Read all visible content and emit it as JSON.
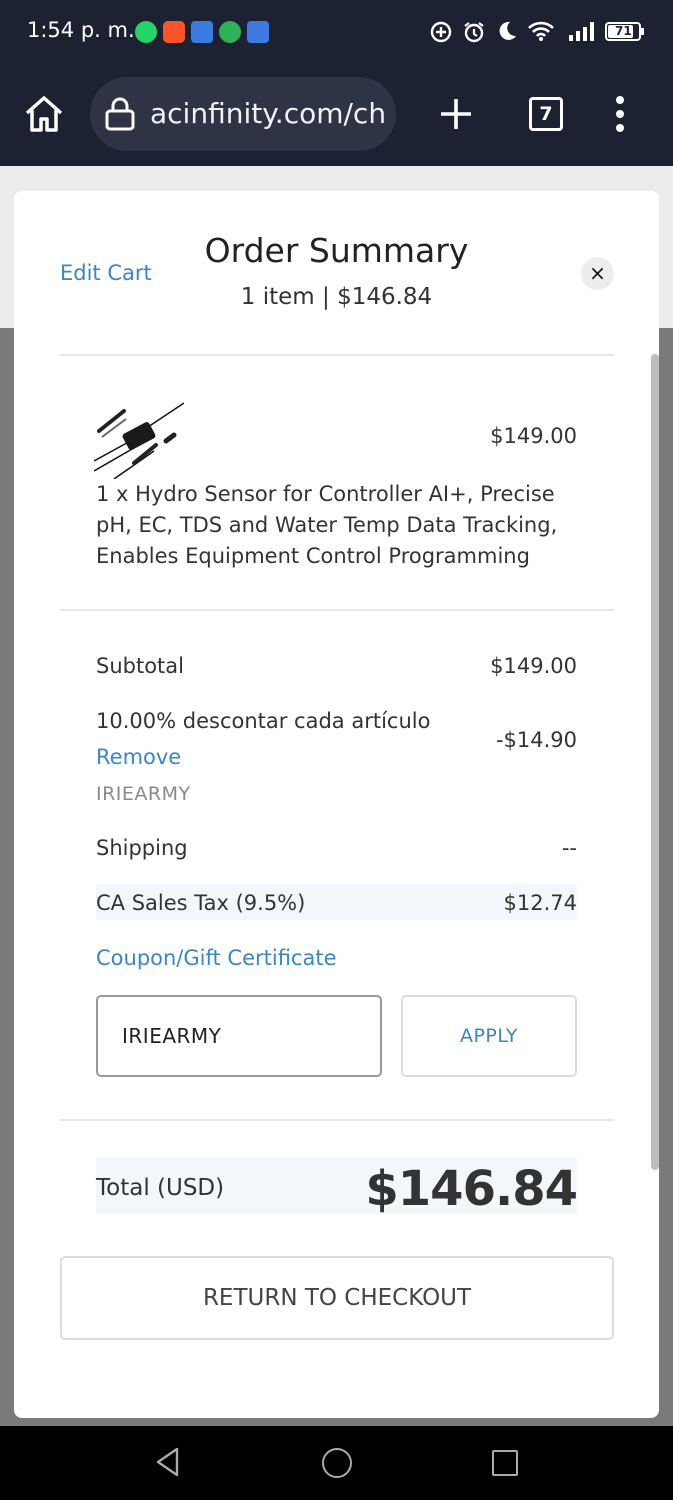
{
  "status_bar": {
    "time": "1:54 p. m.",
    "battery": "71"
  },
  "browser": {
    "url": "acinfinity.com/ch",
    "tab_count": "7"
  },
  "modal": {
    "edit_cart": "Edit Cart",
    "title": "Order Summary",
    "subtitle": "1 item | $146.84",
    "close": "×"
  },
  "product": {
    "price": "$149.00",
    "description": "1 x Hydro Sensor for Controller AI+, Precise pH, EC, TDS and Water Temp Data Tracking, Enables Equipment Control Programming"
  },
  "summary": {
    "subtotal_label": "Subtotal",
    "subtotal_value": "$149.00",
    "discount_label": "10.00% descontar cada artículo",
    "discount_value": "-$14.90",
    "remove_label": "Remove",
    "discount_code": "IRIEARMY",
    "shipping_label": "Shipping",
    "shipping_value": "--",
    "tax_label": "CA Sales Tax (9.5%)",
    "tax_value": "$12.74"
  },
  "coupon": {
    "label": "Coupon/Gift Certificate",
    "input_value": "IRIEARMY",
    "apply_label": "APPLY"
  },
  "total": {
    "label": "Total (USD)",
    "value": "$146.84"
  },
  "return_button": "RETURN TO CHECKOUT"
}
